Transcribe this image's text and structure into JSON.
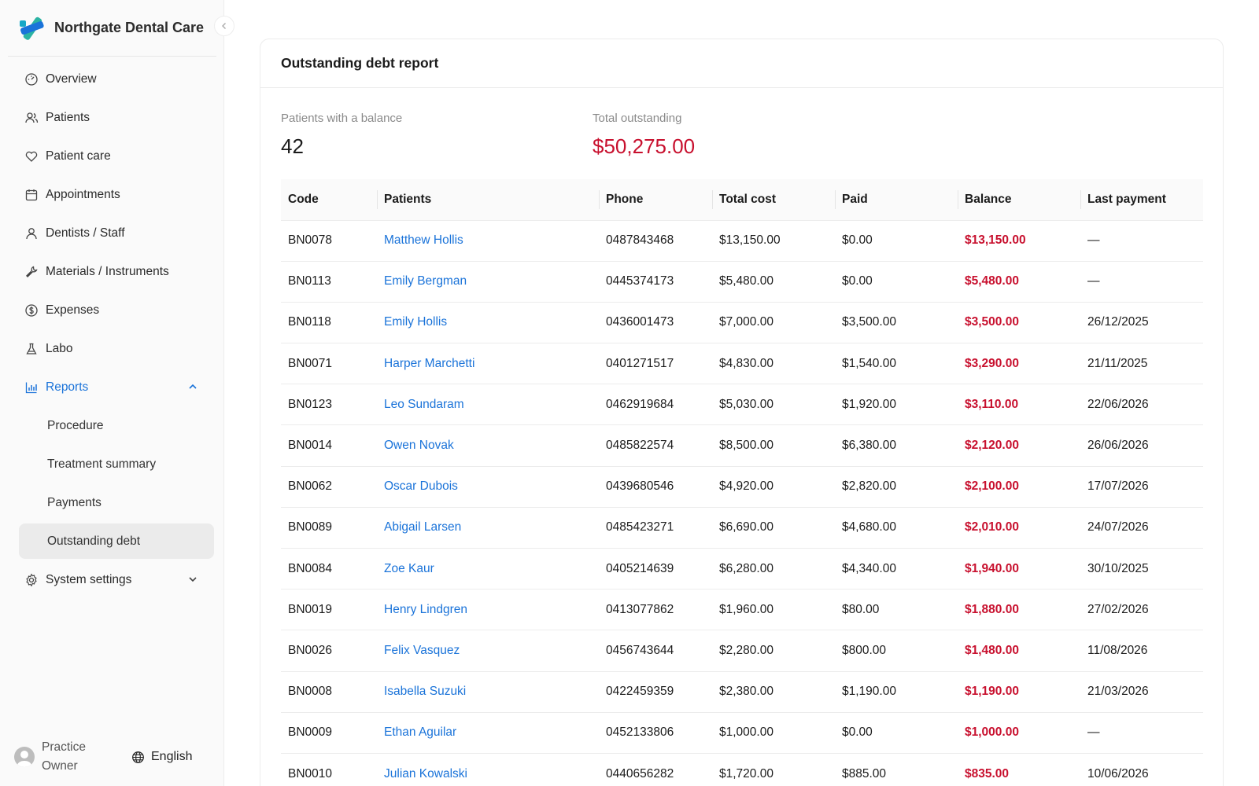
{
  "brand": {
    "name": "Northgate Dental Care"
  },
  "sidebar": {
    "items": [
      {
        "label": "Overview",
        "icon": "dashboard-icon"
      },
      {
        "label": "Patients",
        "icon": "users-icon"
      },
      {
        "label": "Patient care",
        "icon": "heart-icon"
      },
      {
        "label": "Appointments",
        "icon": "calendar-icon"
      },
      {
        "label": "Dentists / Staff",
        "icon": "user-icon"
      },
      {
        "label": "Materials / Instruments",
        "icon": "wrench-icon"
      },
      {
        "label": "Expenses",
        "icon": "dollar-icon"
      },
      {
        "label": "Labo",
        "icon": "flask-icon"
      },
      {
        "label": "Reports",
        "icon": "bar-chart-icon"
      }
    ],
    "reports_sub": [
      "Procedure",
      "Treatment summary",
      "Payments",
      "Outstanding debt"
    ],
    "settings": {
      "label": "System settings",
      "icon": "gear-icon"
    },
    "user": {
      "name": "Practice Owner"
    },
    "language": "English",
    "accent": "#1a73d9"
  },
  "report": {
    "title": "Outstanding debt report",
    "stats": {
      "patients_label": "Patients with a balance",
      "patients_value": "42",
      "total_label": "Total outstanding",
      "total_value": "$50,275.00"
    },
    "columns": [
      "Code",
      "Patients",
      "Phone",
      "Total cost",
      "Paid",
      "Balance",
      "Last payment"
    ],
    "rows": [
      {
        "code": "BN0078",
        "patient": "Matthew Hollis",
        "phone": "0487843468",
        "total": "$13,150.00",
        "paid": "$0.00",
        "balance": "$13,150.00",
        "last": "—"
      },
      {
        "code": "BN0113",
        "patient": "Emily Bergman",
        "phone": "0445374173",
        "total": "$5,480.00",
        "paid": "$0.00",
        "balance": "$5,480.00",
        "last": "—"
      },
      {
        "code": "BN0118",
        "patient": "Emily Hollis",
        "phone": "0436001473",
        "total": "$7,000.00",
        "paid": "$3,500.00",
        "balance": "$3,500.00",
        "last": "26/12/2025"
      },
      {
        "code": "BN0071",
        "patient": "Harper Marchetti",
        "phone": "0401271517",
        "total": "$4,830.00",
        "paid": "$1,540.00",
        "balance": "$3,290.00",
        "last": "21/11/2025"
      },
      {
        "code": "BN0123",
        "patient": "Leo Sundaram",
        "phone": "0462919684",
        "total": "$5,030.00",
        "paid": "$1,920.00",
        "balance": "$3,110.00",
        "last": "22/06/2026"
      },
      {
        "code": "BN0014",
        "patient": "Owen Novak",
        "phone": "0485822574",
        "total": "$8,500.00",
        "paid": "$6,380.00",
        "balance": "$2,120.00",
        "last": "26/06/2026"
      },
      {
        "code": "BN0062",
        "patient": "Oscar Dubois",
        "phone": "0439680546",
        "total": "$4,920.00",
        "paid": "$2,820.00",
        "balance": "$2,100.00",
        "last": "17/07/2026"
      },
      {
        "code": "BN0089",
        "patient": "Abigail Larsen",
        "phone": "0485423271",
        "total": "$6,690.00",
        "paid": "$4,680.00",
        "balance": "$2,010.00",
        "last": "24/07/2026"
      },
      {
        "code": "BN0084",
        "patient": "Zoe Kaur",
        "phone": "0405214639",
        "total": "$6,280.00",
        "paid": "$4,340.00",
        "balance": "$1,940.00",
        "last": "30/10/2025"
      },
      {
        "code": "BN0019",
        "patient": "Henry Lindgren",
        "phone": "0413077862",
        "total": "$1,960.00",
        "paid": "$80.00",
        "balance": "$1,880.00",
        "last": "27/02/2026"
      },
      {
        "code": "BN0026",
        "patient": "Felix Vasquez",
        "phone": "0456743644",
        "total": "$2,280.00",
        "paid": "$800.00",
        "balance": "$1,480.00",
        "last": "11/08/2026"
      },
      {
        "code": "BN0008",
        "patient": "Isabella Suzuki",
        "phone": "0422459359",
        "total": "$2,380.00",
        "paid": "$1,190.00",
        "balance": "$1,190.00",
        "last": "21/03/2026"
      },
      {
        "code": "BN0009",
        "patient": "Ethan Aguilar",
        "phone": "0452133806",
        "total": "$1,000.00",
        "paid": "$0.00",
        "balance": "$1,000.00",
        "last": "—"
      },
      {
        "code": "BN0010",
        "patient": "Julian Kowalski",
        "phone": "0440656282",
        "total": "$1,720.00",
        "paid": "$885.00",
        "balance": "$835.00",
        "last": "10/06/2026"
      }
    ],
    "negative_color": "#c8102e"
  }
}
